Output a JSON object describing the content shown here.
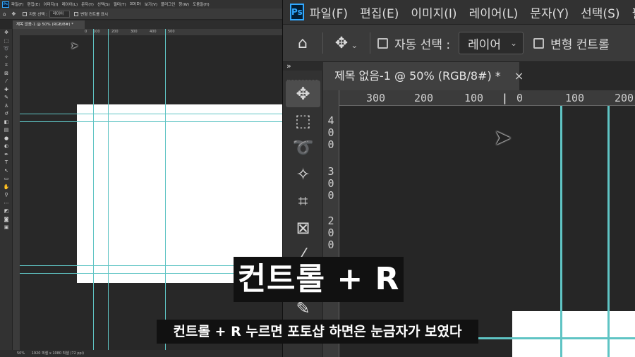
{
  "left_window": {
    "ps_badge": "Ps",
    "menu": [
      "파일(F)",
      "편집(E)",
      "이미지(I)",
      "레이어(L)",
      "문자(Y)",
      "선택(S)",
      "필터(T)",
      "3D(D)",
      "보기(V)",
      "플러그인",
      "창(W)",
      "도움말(H)"
    ],
    "options": {
      "auto_select_label": "자동 선택 :",
      "auto_select_value": "레이어",
      "transform_controls_label": "변형 컨트롤 표시"
    },
    "doc_tab": "제목 없음-1 @ 50% (RGB/8#) *",
    "ruler_h": [
      "0",
      "100",
      "200",
      "300",
      "400",
      "500"
    ],
    "status_zoom": "50%",
    "status_info": "1920 픽셀 x 1080 픽셀 (72 ppi)"
  },
  "right_window": {
    "ps_badge": "Ps",
    "menu": [
      "파일(F)",
      "편집(E)",
      "이미지(I)",
      "레이어(L)",
      "문자(Y)",
      "선택(S)",
      "필"
    ],
    "options": {
      "auto_select_label": "자동 선택 :",
      "auto_select_value": "레이어",
      "transform_controls_label": "변형 컨트롤"
    },
    "panel_collapse": "»",
    "doc_tab": "제목 없음-1 @ 50% (RGB/8#) *",
    "doc_tab_close": "×",
    "ruler_h": [
      "300",
      "200",
      "100",
      "0",
      "100",
      "200"
    ],
    "ruler_v": [
      [
        "4",
        "0",
        "0"
      ],
      [
        "3",
        "0",
        "0"
      ],
      [
        "2",
        "0",
        "0"
      ]
    ]
  },
  "subtitles": {
    "big": "컨트롤 + R",
    "small": "컨트롤 + R 누르면 포토샵 하면은 눈금자가 보였다"
  },
  "colors": {
    "guide": "#5fc4c4",
    "ps_blue": "#31a8ff",
    "menubar": "#323232",
    "canvas": "#262626"
  }
}
